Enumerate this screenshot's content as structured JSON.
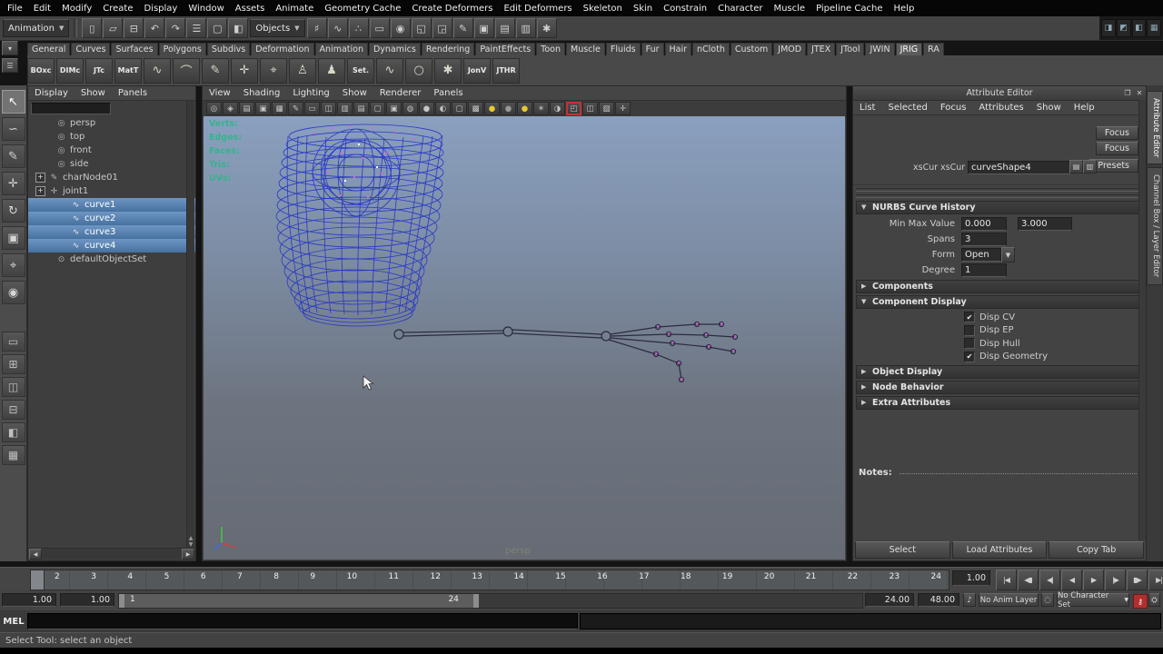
{
  "menubar": {
    "items": [
      "File",
      "Edit",
      "Modify",
      "Create",
      "Display",
      "Window",
      "Assets",
      "Animate",
      "Geometry Cache",
      "Create Deformers",
      "Edit Deformers",
      "Skeleton",
      "Skin",
      "Constrain",
      "Character",
      "Muscle",
      "Pipeline Cache",
      "Help"
    ]
  },
  "toolbar": {
    "mode": "Animation",
    "objects": "Objects",
    "icons_a": [
      {
        "name": "new-scene-icon",
        "glyph": "▯"
      },
      {
        "name": "open-scene-icon",
        "glyph": "▱"
      },
      {
        "name": "save-scene-icon",
        "glyph": "⊟"
      },
      {
        "name": "undo-icon",
        "glyph": "↶"
      },
      {
        "name": "redo-icon",
        "glyph": "↷"
      },
      {
        "name": "select-by-hierarchy-icon",
        "glyph": "☰"
      },
      {
        "name": "select-by-object-type-icon",
        "glyph": "▢"
      },
      {
        "name": "select-by-component-type-icon",
        "glyph": "◧"
      }
    ],
    "icons_b": [
      {
        "name": "snap-to-grid-icon",
        "glyph": "♯"
      },
      {
        "name": "snap-to-curve-icon",
        "glyph": "∿"
      },
      {
        "name": "snap-to-point-icon",
        "glyph": "∴"
      },
      {
        "name": "snap-to-view-plane-icon",
        "glyph": "▭"
      },
      {
        "name": "make-live-icon",
        "glyph": "◉"
      },
      {
        "name": "input-to-selected-icon",
        "glyph": "◱"
      },
      {
        "name": "output-of-selected-icon",
        "glyph": "◲"
      },
      {
        "name": "construction-history-icon",
        "glyph": "✎"
      },
      {
        "name": "open-render-view-icon",
        "glyph": "▣"
      },
      {
        "name": "render-current-frame-icon",
        "glyph": "▤"
      },
      {
        "name": "ipr-render-icon",
        "glyph": "▥"
      },
      {
        "name": "render-settings-icon",
        "glyph": "✱"
      }
    ],
    "right_icons": [
      {
        "name": "toggle-attribute-editor-icon",
        "glyph": "◨"
      },
      {
        "name": "toggle-tool-settings-icon",
        "glyph": "◩"
      },
      {
        "name": "toggle-channel-box-icon",
        "glyph": "◧"
      },
      {
        "name": "toggle-panel-layouts-icon",
        "glyph": "▦"
      }
    ]
  },
  "shelf": {
    "tabs": [
      {
        "label": "General",
        "state": ""
      },
      {
        "label": "Curves",
        "state": ""
      },
      {
        "label": "Surfaces",
        "state": ""
      },
      {
        "label": "Polygons",
        "state": ""
      },
      {
        "label": "Subdivs",
        "state": ""
      },
      {
        "label": "Deformation",
        "state": ""
      },
      {
        "label": "Animation",
        "state": ""
      },
      {
        "label": "Dynamics",
        "state": ""
      },
      {
        "label": "Rendering",
        "state": ""
      },
      {
        "label": "PaintEffects",
        "state": ""
      },
      {
        "label": "Toon",
        "state": ""
      },
      {
        "label": "Muscle",
        "state": ""
      },
      {
        "label": "Fluids",
        "state": ""
      },
      {
        "label": "Fur",
        "state": ""
      },
      {
        "label": "Hair",
        "state": ""
      },
      {
        "label": "nCloth",
        "state": ""
      },
      {
        "label": "Custom",
        "state": ""
      },
      {
        "label": "JMOD",
        "state": ""
      },
      {
        "label": "JTEX",
        "state": ""
      },
      {
        "label": "JTool",
        "state": ""
      },
      {
        "label": "JWIN",
        "state": ""
      },
      {
        "label": "JRIG",
        "state": "active"
      },
      {
        "label": "RA",
        "state": ""
      }
    ],
    "items": [
      {
        "name": "shelf-boxc-button",
        "label": "BOxc"
      },
      {
        "name": "shelf-dimc-button",
        "label": "DIMc"
      },
      {
        "name": "shelf-jtc-button",
        "label": "JTc"
      },
      {
        "name": "shelf-matt-button",
        "label": "MatT"
      },
      {
        "name": "shelf-cv-curve-icon",
        "glyph": "∿"
      },
      {
        "name": "shelf-ep-curve-icon",
        "glyph": "⌒"
      },
      {
        "name": "shelf-pencil-curve-icon",
        "glyph": "✎"
      },
      {
        "name": "shelf-joint-tool-icon",
        "glyph": "✛"
      },
      {
        "name": "shelf-ik-handle-icon",
        "glyph": "⌖"
      },
      {
        "name": "shelf-character-walk-icon",
        "glyph": "♙"
      },
      {
        "name": "shelf-character-run-icon",
        "glyph": "♟"
      },
      {
        "name": "shelf-set-button",
        "label": "Set."
      },
      {
        "name": "shelf-curve-icon",
        "glyph": "∿"
      },
      {
        "name": "shelf-circle-icon",
        "glyph": "○"
      },
      {
        "name": "shelf-star-icon",
        "glyph": "✱"
      },
      {
        "name": "shelf-jonv-button",
        "label": "JonV"
      },
      {
        "name": "shelf-jthr-button",
        "label": "JTHR"
      }
    ]
  },
  "toolbox": {
    "tools": [
      {
        "name": "select-tool-icon",
        "glyph": "↖",
        "state": "active"
      },
      {
        "name": "lasso-tool-icon",
        "glyph": "∽",
        "state": ""
      },
      {
        "name": "paint-select-tool-icon",
        "glyph": "✎",
        "state": ""
      },
      {
        "name": "move-tool-icon",
        "glyph": "✛",
        "state": ""
      },
      {
        "name": "rotate-tool-icon",
        "glyph": "↻",
        "state": ""
      },
      {
        "name": "scale-tool-icon",
        "glyph": "▣",
        "state": ""
      },
      {
        "name": "universal-manipulator-icon",
        "glyph": "⌖",
        "state": ""
      },
      {
        "name": "soft-mod-tool-icon",
        "glyph": "◉",
        "state": ""
      }
    ],
    "layouts": [
      {
        "name": "layout-single-pane-icon",
        "glyph": "▭"
      },
      {
        "name": "layout-four-pane-icon",
        "glyph": "⊞"
      },
      {
        "name": "layout-two-pane-icon",
        "glyph": "◫"
      },
      {
        "name": "layout-split-pane-icon",
        "glyph": "⊟"
      },
      {
        "name": "layout-outliner-persp-icon",
        "glyph": "◧"
      },
      {
        "name": "layout-hypergraph-persp-icon",
        "glyph": "▦"
      }
    ]
  },
  "outliner": {
    "menus": [
      "Display",
      "Show",
      "Panels"
    ],
    "items": [
      {
        "label": "persp",
        "glyph": "◎",
        "ind": "ind2",
        "kids": "",
        "state": ""
      },
      {
        "label": "top",
        "glyph": "◎",
        "ind": "ind2",
        "kids": "",
        "state": ""
      },
      {
        "label": "front",
        "glyph": "◎",
        "ind": "ind2",
        "kids": "",
        "state": ""
      },
      {
        "label": "side",
        "glyph": "◎",
        "ind": "ind2",
        "kids": "",
        "state": ""
      },
      {
        "label": "charNode01",
        "glyph": "✎",
        "ind": "ind1",
        "kids": "haskids",
        "state": ""
      },
      {
        "label": "joint1",
        "glyph": "✛",
        "ind": "ind1",
        "kids": "haskids",
        "state": ""
      },
      {
        "label": "curve1",
        "glyph": "∿",
        "ind": "ind3",
        "kids": "",
        "state": "selected"
      },
      {
        "label": "curve2",
        "glyph": "∿",
        "ind": "ind3",
        "kids": "",
        "state": "selected"
      },
      {
        "label": "curve3",
        "glyph": "∿",
        "ind": "ind3",
        "kids": "",
        "state": "selected"
      },
      {
        "label": "curve4",
        "glyph": "∿",
        "ind": "ind3",
        "kids": "",
        "state": "selected"
      },
      {
        "label": "defaultObjectSet",
        "glyph": "⊙",
        "ind": "ind2",
        "kids": "",
        "state": ""
      }
    ]
  },
  "viewport": {
    "menus": [
      "View",
      "Shading",
      "Lighting",
      "Show",
      "Renderer",
      "Panels"
    ],
    "icons": [
      {
        "name": "select-camera-icon",
        "glyph": "◎",
        "cls": ""
      },
      {
        "name": "lock-camera-icon",
        "glyph": "◈",
        "cls": ""
      },
      {
        "name": "camera-attributes-icon",
        "glyph": "▤",
        "cls": ""
      },
      {
        "name": "bookmarks-icon",
        "glyph": "▣",
        "cls": ""
      },
      {
        "name": "image-plane-icon",
        "glyph": "▦",
        "cls": ""
      },
      {
        "name": "grease-pencil-icon",
        "glyph": "✎",
        "cls": ""
      },
      {
        "name": "film-gate-icon",
        "glyph": "▭",
        "cls": ""
      },
      {
        "name": "resolution-gate-icon",
        "glyph": "◫",
        "cls": ""
      },
      {
        "name": "gate-mask-icon",
        "glyph": "▥",
        "cls": ""
      },
      {
        "name": "field-chart-icon",
        "glyph": "▤",
        "cls": ""
      },
      {
        "name": "safe-action-icon",
        "glyph": "▢",
        "cls": ""
      },
      {
        "name": "safe-title-icon",
        "glyph": "▣",
        "cls": ""
      },
      {
        "name": "wireframe-mode-icon",
        "glyph": "◍",
        "cls": ""
      },
      {
        "name": "smooth-shade-icon",
        "glyph": "●",
        "cls": ""
      },
      {
        "name": "flat-shade-icon",
        "glyph": "◐",
        "cls": ""
      },
      {
        "name": "bounding-box-icon",
        "glyph": "▢",
        "cls": ""
      },
      {
        "name": "textured-mode-icon",
        "glyph": "▩",
        "cls": ""
      },
      {
        "name": "default-material-icon",
        "glyph": "●",
        "cls": "yellow"
      },
      {
        "name": "no-texture-icon",
        "glyph": "●",
        "cls": "gray"
      },
      {
        "name": "textured-ball-icon",
        "glyph": "●",
        "cls": "yellow"
      },
      {
        "name": "use-default-lighting-icon",
        "glyph": "☀",
        "cls": ""
      },
      {
        "name": "shadows-icon",
        "glyph": "◑",
        "cls": ""
      },
      {
        "name": "isolate-select-icon",
        "glyph": "◰",
        "cls": "alert"
      },
      {
        "name": "xray-icon",
        "glyph": "◫",
        "cls": ""
      },
      {
        "name": "backface-culling-icon",
        "glyph": "▧",
        "cls": ""
      },
      {
        "name": "joints-xray-icon",
        "glyph": "✛",
        "cls": ""
      }
    ],
    "hud": [
      "Verts:",
      "Edges:",
      "Faces:",
      "Tris:",
      "UVs:"
    ],
    "camera_label": "persp"
  },
  "attribute_editor": {
    "title": "Attribute Editor",
    "menus": [
      "List",
      "Selected",
      "Focus",
      "Attributes",
      "Show",
      "Help"
    ],
    "focus_button": "Focus",
    "presets_button": "Presets",
    "tab1": "xsCur",
    "tab2": "xsCur",
    "shape_field": "curveShape4",
    "sections": {
      "nurbs": {
        "title": "NURBS Curve History",
        "min_max_label": "Min Max Value",
        "min": "0.000",
        "max": "3.000",
        "spans_label": "Spans",
        "spans": "3",
        "form_label": "Form",
        "form": "Open",
        "degree_label": "Degree",
        "degree": "1"
      },
      "components": "Components",
      "component_display": {
        "title": "Component Display",
        "checks": [
          {
            "name": "disp-cv-checkbox",
            "label": "Disp CV",
            "state": "checked"
          },
          {
            "name": "disp-ep-checkbox",
            "label": "Disp EP",
            "state": ""
          },
          {
            "name": "disp-hull-checkbox",
            "label": "Disp Hull",
            "state": ""
          },
          {
            "name": "disp-geometry-checkbox",
            "label": "Disp Geometry",
            "state": "checked"
          }
        ]
      },
      "object_display": "Object Display",
      "node_behavior": "Node Behavior",
      "extra_attributes": "Extra Attributes"
    },
    "notes_label": "Notes:",
    "buttons": [
      "Select",
      "Load Attributes",
      "Copy Tab"
    ]
  },
  "side_tabs": [
    "Attribute Editor",
    "Channel Box / Layer Editor"
  ],
  "timeline": {
    "numbers": [
      "2",
      "3",
      "4",
      "5",
      "6",
      "7",
      "8",
      "9",
      "10",
      "11",
      "12",
      "13",
      "14",
      "15",
      "16",
      "17",
      "18",
      "19",
      "20",
      "21",
      "22",
      "23",
      "24"
    ],
    "current_time": "1.00",
    "playback": [
      {
        "name": "go-to-start-button",
        "glyph": "|◀"
      },
      {
        "name": "step-back-frame-button",
        "glyph": "◀▮"
      },
      {
        "name": "step-back-key-button",
        "glyph": "◀|"
      },
      {
        "name": "play-backwards-button",
        "glyph": "◀"
      },
      {
        "name": "play-forwards-button",
        "glyph": "▶"
      },
      {
        "name": "step-forward-key-button",
        "glyph": "|▶"
      },
      {
        "name": "step-forward-frame-button",
        "glyph": "▮▶"
      },
      {
        "name": "go-to-end-button",
        "glyph": "▶|"
      }
    ]
  },
  "range_slider": {
    "start": "1.00",
    "min": "1.00",
    "range_start": "1",
    "range_end": "24",
    "end": "24.00",
    "max": "48.00",
    "anim_layer": "No Anim Layer",
    "character_set": "No Character Set"
  },
  "command_line": {
    "label": "MEL"
  },
  "help_line": {
    "text": "Select Tool: select an object"
  }
}
